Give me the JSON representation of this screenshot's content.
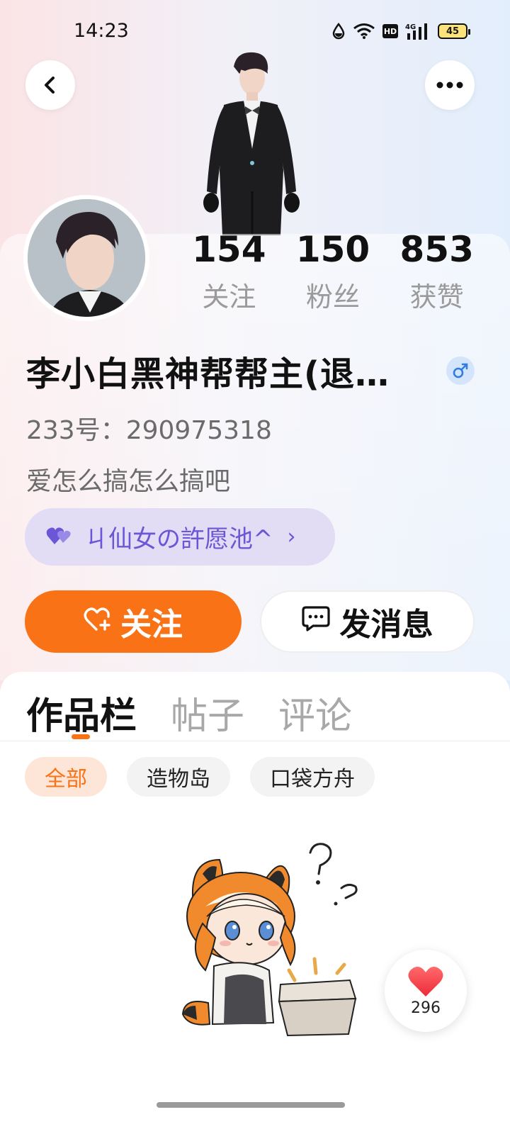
{
  "status_bar": {
    "time": "14:23",
    "battery": "45",
    "hd_label": "HD",
    "network_label": "4G",
    "icons": [
      "drop-icon",
      "wifi-icon",
      "hd-icon",
      "signal-4g-icon",
      "battery-icon"
    ]
  },
  "header": {
    "back_icon": "chevron-left-icon",
    "more_icon": "more-dots-icon"
  },
  "stats": [
    {
      "value": "154",
      "label": "关注"
    },
    {
      "value": "150",
      "label": "粉丝"
    },
    {
      "value": "853",
      "label": "获赞"
    }
  ],
  "profile": {
    "username": "李小白黑神帮帮主(退…",
    "gender_icon": "male-icon",
    "user_id": "233号：290975318",
    "bio": "爱怎么搞怎么搞吧",
    "guild": "ㄐ仙女の許愿池^",
    "guild_chevron": "›"
  },
  "actions": {
    "follow_label": "关注",
    "message_label": "发消息"
  },
  "tabs": [
    {
      "label": "作品栏",
      "active": true
    },
    {
      "label": "帖子",
      "active": false
    },
    {
      "label": "评论",
      "active": false
    }
  ],
  "filters": [
    {
      "label": "全部",
      "active": true
    },
    {
      "label": "造物岛",
      "active": false
    },
    {
      "label": "口袋方舟",
      "active": false
    }
  ],
  "like_float": {
    "count": "296"
  },
  "colors": {
    "accent": "#f97316",
    "guild_text": "#6a56d6",
    "guild_bg": "#e2dcf5"
  }
}
